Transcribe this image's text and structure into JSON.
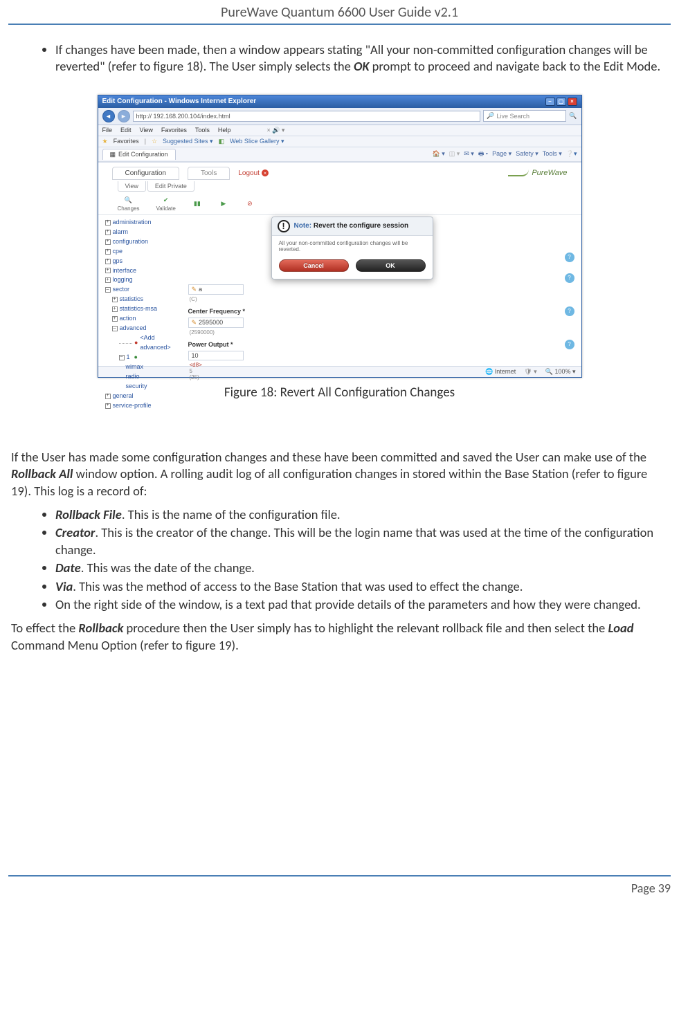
{
  "header": {
    "title": "PureWave Quantum 6600 User Guide v2.1"
  },
  "intro_bullet": {
    "pre": "If changes have been made, then a window appears stating \"All your non-committed configuration changes will be reverted\" (refer to figure 18). The User simply selects the ",
    "ok": "OK",
    "post": " prompt to proceed and navigate back to the Edit Mode."
  },
  "figure": {
    "caption": "Figure 18: Revert All Configuration Changes",
    "win_title": "Edit Configuration - Windows Internet Explorer",
    "url": "http:// 192.168.200.104/index.html",
    "search_placeholder": "Live Search",
    "menu": [
      "File",
      "Edit",
      "View",
      "Favorites",
      "Tools",
      "Help"
    ],
    "fav_label": "Favorites",
    "fav_links": [
      "Suggested Sites ▾",
      "Web Slice Gallery ▾"
    ],
    "tab_label": "Edit Configuration",
    "ie_tools": [
      "Page ▾",
      "Safety ▾",
      "Tools ▾"
    ],
    "app_tabs": {
      "config": "Configuration",
      "tools": "Tools",
      "logout": "Logout"
    },
    "brand": "PureWave",
    "sub_tabs": [
      "View",
      "Edit Private"
    ],
    "toolbar_labels": {
      "changes": "Changes",
      "validate": "Validate"
    },
    "tree": {
      "administration": "administration",
      "alarm": "alarm",
      "configuration": "configuration",
      "cpe": "cpe",
      "gps": "gps",
      "interface": "interface",
      "logging": "logging",
      "sector": "sector",
      "statistics": "statistics",
      "statistics_msa": "statistics-msa",
      "action": "action",
      "advanced": "advanced",
      "add_advanced": "<Add advanced>",
      "one": "1",
      "wimax": "wimax",
      "radio": "radio",
      "security": "security",
      "general": "general",
      "service_profile": "service-profile"
    },
    "form": {
      "row_a_val": "a",
      "row_a_sub": "(C)",
      "center_freq_label": "Center Frequency *",
      "center_freq_val": "2595000",
      "center_freq_sub": "(2590000)",
      "power_label": "Power Output *",
      "power_val": "10",
      "power_unit": "<d8>",
      "power_sub_a": "5",
      "power_sub_b": "(25)"
    },
    "dialog": {
      "note": "Note:",
      "title": "Revert the configure session",
      "body": "All your non-committed configuration changes will be reverted.",
      "cancel": "Cancel",
      "ok": "OK"
    },
    "status": {
      "internet": "Internet",
      "zoom": "100%"
    }
  },
  "para1": {
    "pre": "If the User has made some configuration changes and these have been committed and saved the User can make use of the ",
    "bold": "Rollback All",
    "post": " window option. A rolling audit log of all configuration changes in stored within the Base Station (refer to figure 19). This log is a record of:"
  },
  "bullets": {
    "b1": {
      "bold": "Rollback File",
      "rest": ". This is the name of the configuration file."
    },
    "b2": {
      "bold": "Creator",
      "rest": ". This is the creator of the change. This will be the login name that was used at the time of the configuration change."
    },
    "b3": {
      "bold": "Date",
      "rest": ". This was the date of the change."
    },
    "b4": {
      "bold": "Via",
      "rest": ". This was the method of access to the Base Station that was used to effect the change."
    },
    "b5": {
      "rest": "On the right side of the window, is a text pad that provide details of the parameters and how they were changed."
    }
  },
  "para2": {
    "pre": "To effect the ",
    "bold1": "Rollback",
    "mid": " procedure then the User simply has to highlight the relevant rollback file and then select the ",
    "bold2": "Load",
    "post": " Command Menu Option (refer to figure 19)."
  },
  "footer": {
    "page": "Page 39"
  }
}
